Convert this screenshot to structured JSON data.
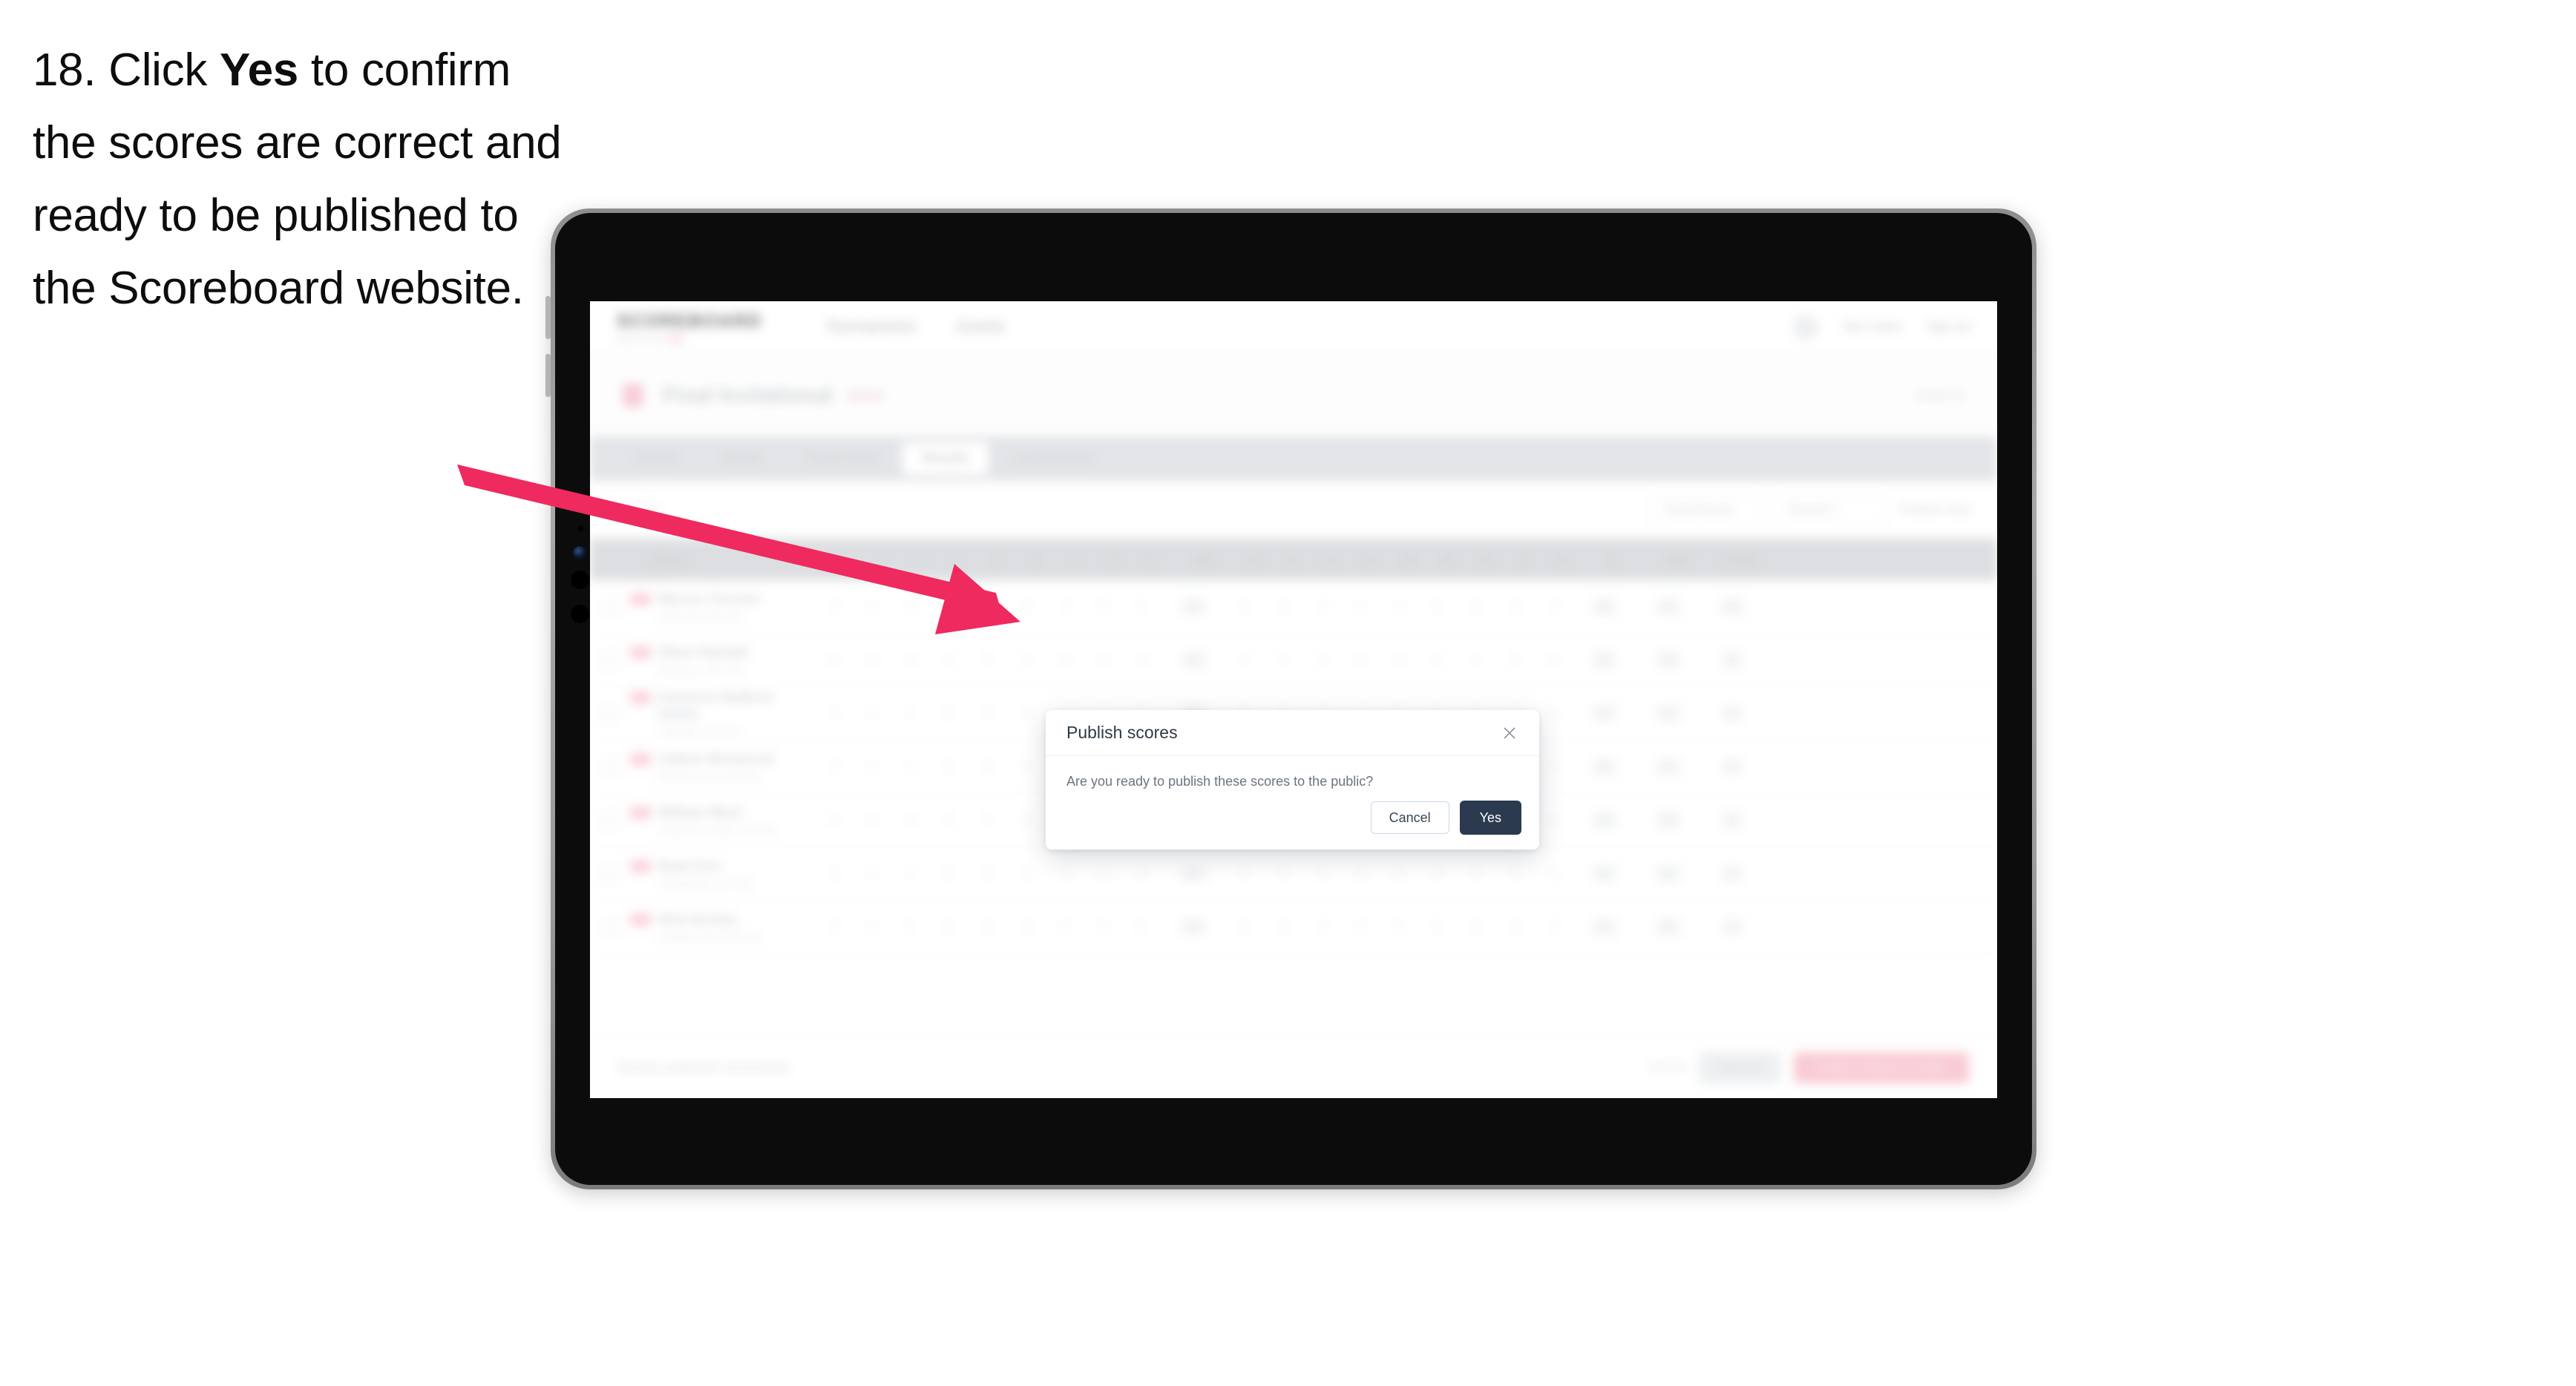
{
  "caption": {
    "number": "18.",
    "before_bold": " Click ",
    "bold": "Yes",
    "after_bold": " to confirm the scores are correct and ready to be published to the Scoreboard website."
  },
  "colors": {
    "arrow": "#EE2A5F",
    "primary_button": "#2C3A4F",
    "cancel_border": "#C9D7EA",
    "brand_accent": "#F06A8A"
  },
  "modal": {
    "title": "Publish scores",
    "close_icon": "close-icon",
    "body": "Are you ready to publish these scores to the public?",
    "buttons": {
      "cancel": "Cancel",
      "confirm": "Yes"
    }
  },
  "app": {
    "header": {
      "brand": "SCOREBOARD",
      "brand_sub": "powered by",
      "brand_sub_tag": "club",
      "nav": [
        "Tournaments",
        "Events"
      ],
      "avatar": "avatar",
      "links": [
        "Tom Carter",
        "Sign out"
      ]
    },
    "page": {
      "title": "Final Invitational",
      "title_sub": "2024",
      "title_right": "Event ID"
    },
    "tabs": [
      {
        "label": "Details",
        "active": false
      },
      {
        "label": "Draws",
        "active": false
      },
      {
        "label": "Score Entry",
        "active": false
      },
      {
        "label": "Results",
        "active": true
      },
      {
        "label": "Leaderboard",
        "active": false
      }
    ],
    "filters": {
      "search_placeholder": "Search",
      "selects": [
        "Final Round",
        "Round 1"
      ],
      "label": "Publish Only"
    },
    "table": {
      "columns": [
        "Player",
        "1",
        "2",
        "3",
        "4",
        "5",
        "6",
        "7",
        "8",
        "9",
        "Out",
        "10",
        "11",
        "12",
        "13",
        "14",
        "15",
        "16",
        "17",
        "18",
        "In",
        "Total",
        "Points"
      ],
      "rows": [
        {
          "flag": "flag",
          "name": "Marcus Tennant",
          "sub": "Oakwood Golf Club",
          "scores": [
            "4",
            "4",
            "3",
            "5",
            "4",
            "3",
            "4",
            "5",
            "4",
            "36",
            "4",
            "5",
            "3",
            "4",
            "4",
            "5",
            "3",
            "4",
            "4",
            "36",
            "72",
            "10"
          ]
        },
        {
          "flag": "flag",
          "name": "Oliver Randall",
          "sub": "Ridgeway Golf Club",
          "scores": [
            "5",
            "4",
            "3",
            "4",
            "5",
            "4",
            "3",
            "5",
            "4",
            "37",
            "4",
            "4",
            "4",
            "5",
            "3",
            "4",
            "4",
            "5",
            "4",
            "37",
            "74",
            "8"
          ]
        },
        {
          "flag": "flag",
          "name": "Cameron Radford-Searle",
          "sub": "Lakeside Golf Club",
          "scores": [
            "4",
            "5",
            "3",
            "5",
            "4",
            "4",
            "4",
            "4",
            "5",
            "38",
            "5",
            "4",
            "3",
            "4",
            "5",
            "4",
            "4",
            "4",
            "4",
            "37",
            "75",
            "6"
          ]
        },
        {
          "flag": "flag",
          "name": "Callum Westwood",
          "sub": "Brackley Park Golf Club",
          "scores": [
            "5",
            "4",
            "4",
            "5",
            "4",
            "3",
            "5",
            "4",
            "4",
            "38",
            "4",
            "5",
            "4",
            "4",
            "4",
            "5",
            "4",
            "4",
            "4",
            "38",
            "76",
            "5"
          ]
        },
        {
          "flag": "flag",
          "name": "William Ward",
          "sub": "Hazelmere Heath Golf Club",
          "scores": [
            "4",
            "5",
            "4",
            "5",
            "5",
            "4",
            "4",
            "5",
            "4",
            "40",
            "5",
            "4",
            "4",
            "5",
            "4",
            "4",
            "5",
            "4",
            "4",
            "39",
            "79",
            "4"
          ]
        },
        {
          "flag": "flag",
          "name": "Ryan Kerr",
          "sub": "Stonebridge Golf Club",
          "scores": [
            "5",
            "5",
            "4",
            "5",
            "4",
            "4",
            "5",
            "5",
            "4",
            "41",
            "5",
            "5",
            "4",
            "4",
            "5",
            "4",
            "4",
            "5",
            "4",
            "40",
            "81",
            "3"
          ]
        },
        {
          "flag": "flag",
          "name": "Nick Dunlop",
          "sub": "Ashfield Links Golf Club",
          "scores": [
            "5",
            "4",
            "5",
            "5",
            "5",
            "4",
            "5",
            "5",
            "5",
            "43",
            "5",
            "5",
            "4",
            "5",
            "5",
            "4",
            "5",
            "5",
            "4",
            "42",
            "85",
            "2"
          ]
        }
      ]
    },
    "footer": {
      "note": "Results published successfully",
      "link": "Cancel",
      "secondary_button": "Save All",
      "primary_button": "Publish Results to Public"
    }
  }
}
